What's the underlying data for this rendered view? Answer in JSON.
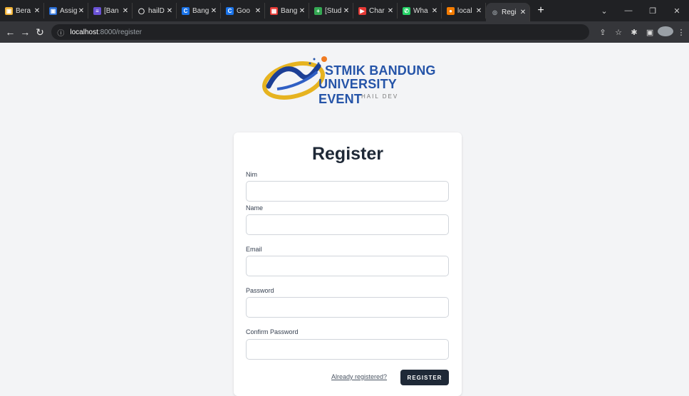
{
  "browser": {
    "tabs": [
      {
        "label": "Bera",
        "icon": "yellow-image-icon",
        "color": "#f2b233",
        "glyph": "▣"
      },
      {
        "label": "Assig",
        "icon": "blue-image-icon",
        "color": "#2b6fd6",
        "glyph": "▣"
      },
      {
        "label": "[Ban",
        "icon": "purple-doc-icon",
        "color": "#6a52d6",
        "glyph": "≡"
      },
      {
        "label": "hailD",
        "icon": "github-icon",
        "color": "#202124",
        "glyph": "◯"
      },
      {
        "label": "Bang",
        "icon": "c-icon",
        "color": "#1a73e8",
        "glyph": "C"
      },
      {
        "label": "Goo",
        "icon": "c-icon",
        "color": "#1a73e8",
        "glyph": "C"
      },
      {
        "label": "Bang",
        "icon": "red-grid-icon",
        "color": "#e53935",
        "glyph": "▦"
      },
      {
        "label": "[Stud",
        "icon": "green-plus-icon",
        "color": "#34a853",
        "glyph": "+"
      },
      {
        "label": "Char",
        "icon": "youtube-icon",
        "color": "#e53935",
        "glyph": "▶"
      },
      {
        "label": "Wha",
        "icon": "whatsapp-icon",
        "color": "#25d366",
        "glyph": "✆"
      },
      {
        "label": "local",
        "icon": "orange-circle-icon",
        "color": "#f57c00",
        "glyph": "●"
      }
    ],
    "active_tab": {
      "label": "Regi",
      "icon": "globe-icon"
    },
    "url_host": "localhost",
    "url_path": ":8000/register"
  },
  "logo": {
    "line1": "STMIK BANDUNG",
    "line2": "UNIVERSITY EVENT",
    "sub": "HAIL DEV"
  },
  "form": {
    "title": "Register",
    "fields": [
      {
        "label": "Nim",
        "value": ""
      },
      {
        "label": "Name",
        "value": ""
      },
      {
        "label": "Email",
        "value": ""
      },
      {
        "label": "Password",
        "value": ""
      },
      {
        "label": "Confirm Password",
        "value": ""
      }
    ],
    "already_link": "Already registered?",
    "submit_label": "REGISTER"
  },
  "colors": {
    "brand_blue": "#2554a8",
    "button_dark": "#1f2937",
    "page_bg": "#f3f4f6"
  }
}
